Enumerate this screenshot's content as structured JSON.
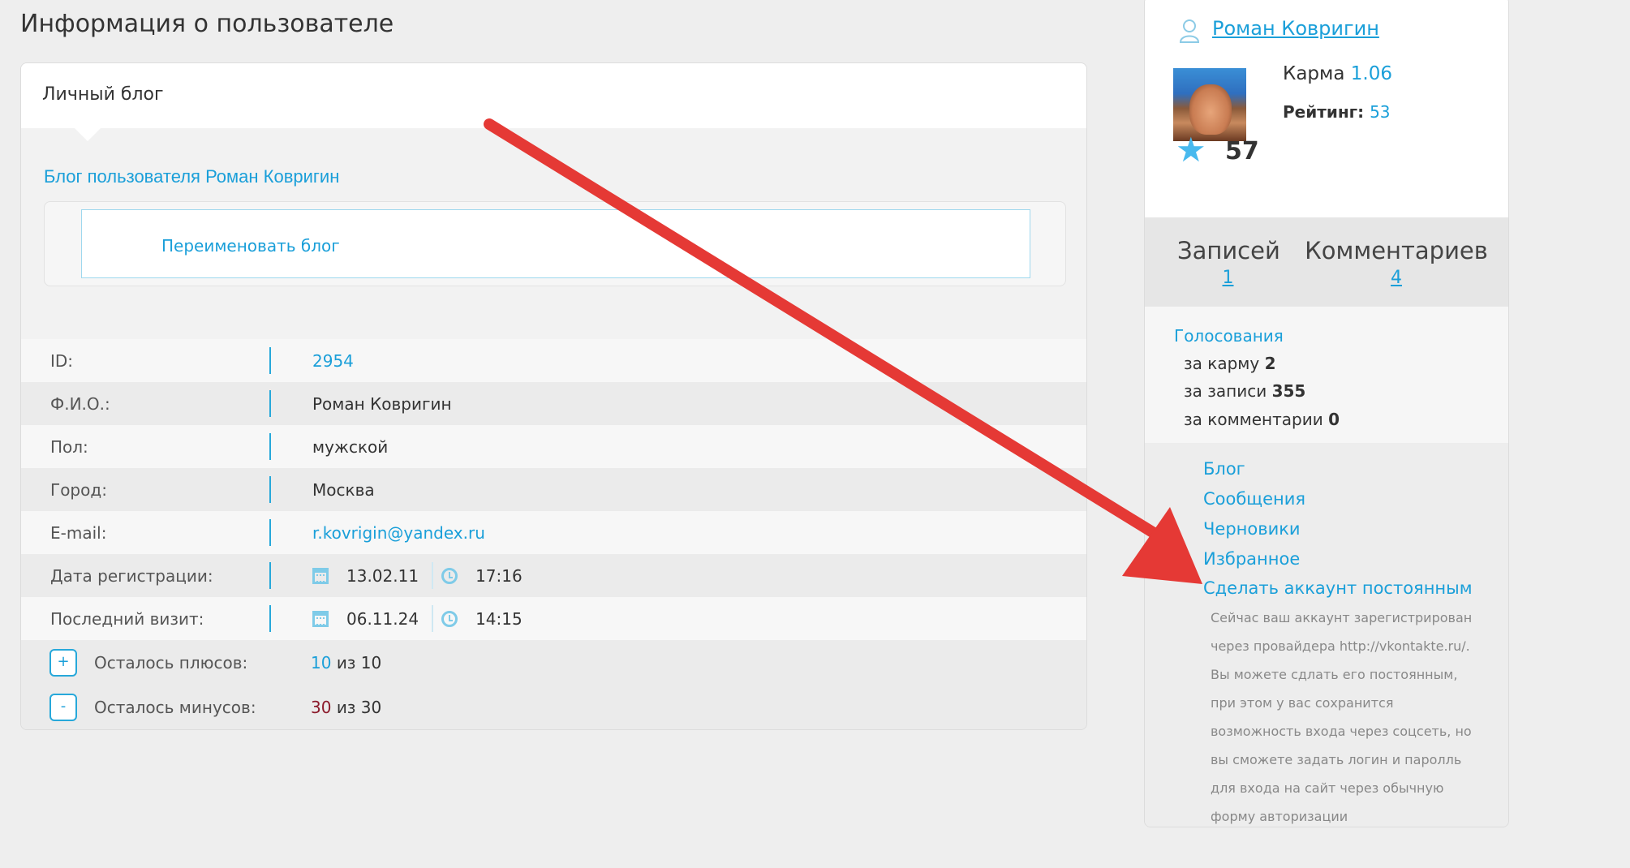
{
  "page": {
    "title": "Информация о пользователе"
  },
  "blog": {
    "header": "Личный блог",
    "blog_link": "Блог пользователя Роман Ковригин",
    "rename_link": "Переименовать блог"
  },
  "info": {
    "rows": [
      {
        "label": "ID:",
        "value": "2954"
      },
      {
        "label": "Ф.И.О.:",
        "value": "Роман Ковригин"
      },
      {
        "label": "Пол:",
        "value": "мужской"
      },
      {
        "label": "Город:",
        "value": "Москва"
      },
      {
        "label": "E-mail:",
        "value": "r.kovrigin@yandex.ru"
      }
    ],
    "registered": {
      "label": "Дата регистрации:",
      "date": "13.02.11",
      "time": "17:16"
    },
    "last_visit": {
      "label": "Последний визит:",
      "date": "06.11.24",
      "time": "14:15"
    }
  },
  "votes_left": {
    "plus": {
      "button": "+",
      "label": "Осталось плюсов:",
      "value": "10",
      "of": "из 10"
    },
    "minus": {
      "button": "-",
      "label": "Осталось минусов:",
      "value": "30",
      "of": "из 30"
    }
  },
  "profile": {
    "name": "Роман Ковригин",
    "karma_label": "Карма",
    "karma_value": "1.06",
    "rating_label": "Рейтинг:",
    "rating_value": "53",
    "star_count": "57"
  },
  "stats": {
    "posts_label": "Записей",
    "posts_count": "1",
    "comments_label": "Комментариев",
    "comments_count": "4"
  },
  "votes": {
    "title": "Голосования",
    "karma": {
      "label": "за карму",
      "value": "2"
    },
    "posts": {
      "label": "за записи",
      "value": "355"
    },
    "comments": {
      "label": "за комментарии",
      "value": "0"
    }
  },
  "menu": {
    "items": [
      "Блог",
      "Сообщения",
      "Черновики",
      "Избранное",
      "Сделать аккаунт постоянным"
    ],
    "description": "Сейчас ваш аккаунт зарегистрирован через провайдера http://vkontakte.ru/. Вы можете сдлать его постоянным, при этом у вас сохранится возможность входа через соцсеть, но вы сможете задать логин и паролль для входа на сайт через обычную форму авторизации"
  },
  "colors": {
    "accent": "#1a9fd9",
    "arrow": "#e53935",
    "minus": "#8b1a2b"
  }
}
